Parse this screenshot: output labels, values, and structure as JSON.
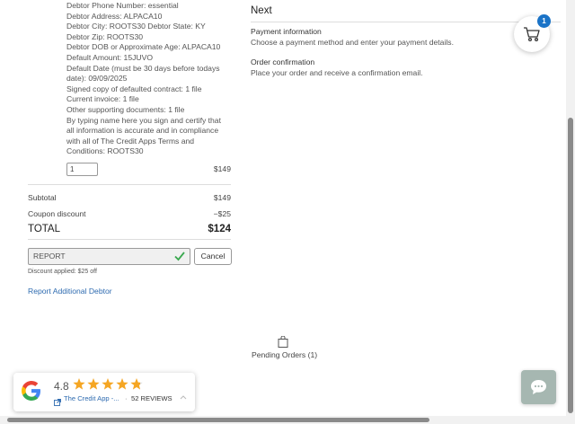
{
  "order_item": {
    "details": [
      "Debtor Phone Number: essential",
      "Debtor Address: ALPACA10",
      "Debtor City: ROOTS30  Debtor State: KY",
      "Debtor Zip: ROOTS30",
      "Debtor DOB or Approximate Age: ALPACA10",
      "Default Amount: 15JUVO",
      "Default Date (must be 30 days before todays",
      "date): 09/09/2025",
      "Signed copy of defaulted contract: 1 file",
      "Current invoice: 1 file",
      "Other supporting documents: 1 file",
      "By typing name here you sign and certify that",
      "all information is accurate and in compliance",
      "with all of The Credit Apps Terms and",
      "Conditions: ROOTS30"
    ],
    "quantity": "1",
    "price": "$149"
  },
  "summary": {
    "subtotal_label": "Subtotal",
    "subtotal_value": "$149",
    "coupon_label": "Coupon discount",
    "coupon_value": "−$25",
    "total_label": "TOTAL",
    "total_value": "$124"
  },
  "coupon": {
    "code": "REPORT",
    "cancel_label": "Cancel",
    "applied_text": "Discount applied: $25 off",
    "check_color": "#3aa84f"
  },
  "report_link": "Report Additional Debtor",
  "next": {
    "heading": "Next",
    "steps": [
      {
        "title": "Payment information",
        "desc": "Choose a payment method and enter your payment details."
      },
      {
        "title": "Order confirmation",
        "desc": "Place your order and receive a confirmation email."
      }
    ]
  },
  "cart": {
    "badge_count": "1",
    "icon": "cart-icon"
  },
  "pending_orders": {
    "label": "Pending Orders (1)",
    "icon": "shopping-bag-icon"
  },
  "reviews": {
    "rating": "4.8",
    "source": "The Credit App -...",
    "count_text": "52 REVIEWS",
    "separator": "·",
    "star_color": "#f5a623",
    "stars_filled": 4.8
  },
  "colors": {
    "accent_blue": "#1a73c7",
    "link_blue": "#2e6bb0",
    "chat_bg": "#a6b7b1"
  }
}
